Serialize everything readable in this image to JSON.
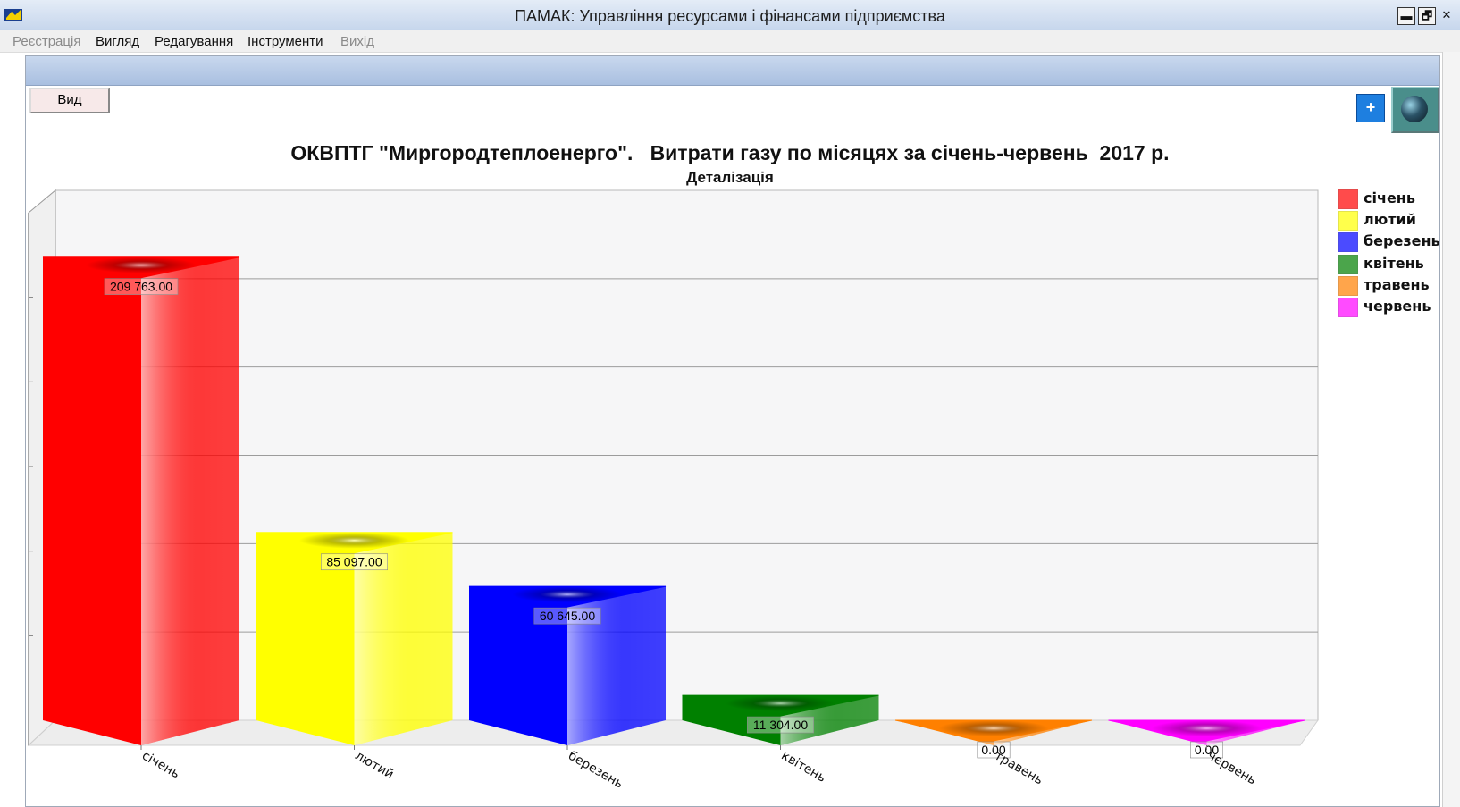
{
  "window": {
    "title": "ПАМАК: Управління ресурсами і фінансами підприємства",
    "minimize_label": "▬",
    "restore_label": "🗗",
    "close_label": "✕"
  },
  "menu": [
    {
      "label": "Реєстрація",
      "enabled": false
    },
    {
      "label": "Вигляд",
      "enabled": true
    },
    {
      "label": "Редагування",
      "enabled": true
    },
    {
      "label": "Інструменти",
      "enabled": true
    },
    {
      "label": "Вихід",
      "enabled": false
    }
  ],
  "toolbar": {
    "view_button_label": "Вид",
    "plus_label": "+"
  },
  "chart_data": {
    "type": "bar",
    "title": "ОКВПТГ \"Миргородтеплоенерго\".   Витрати газу по місяцях за січень-червень  2017 р.",
    "subtitle": "Деталізація",
    "categories": [
      "січень",
      "лютий",
      "березень",
      "квітень",
      "травень",
      "червень"
    ],
    "values": [
      209763.0,
      85097.0,
      60645.0,
      11304.0,
      0.0,
      0.0
    ],
    "value_labels": [
      "209 763.00",
      "85 097.00",
      "60 645.00",
      "11 304.00",
      "0.00",
      "0.00"
    ],
    "colors": [
      "#ff0000",
      "#ffff00",
      "#0000ff",
      "#008000",
      "#ff8000",
      "#ff00ff"
    ],
    "ylim": [
      0,
      240000
    ],
    "grid": true,
    "legend_position": "right",
    "style": "3d-triangle-bars"
  }
}
